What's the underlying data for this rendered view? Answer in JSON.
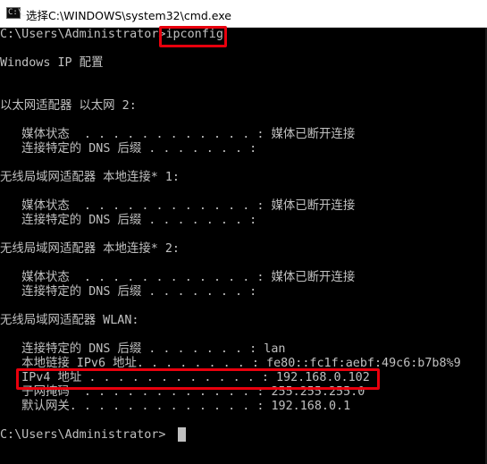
{
  "window": {
    "title": "选择C:\\WINDOWS\\system32\\cmd.exe",
    "icon": "cmd-console-icon",
    "icon_glyph": "C:\\_"
  },
  "console": {
    "prompt1": "C:\\Users\\Administrator>",
    "command": "ipconfig",
    "header": "Windows IP 配置",
    "ethernet": {
      "title": "以太网适配器 以太网 2:",
      "media_state": "   媒体状态  . . . . . . . . . . . . : 媒体已断开连接",
      "dns_suffix": "   连接特定的 DNS 后缀 . . . . . . . :"
    },
    "lan1": {
      "title": "无线局域网适配器 本地连接* 1:",
      "media_state": "   媒体状态  . . . . . . . . . . . . : 媒体已断开连接",
      "dns_suffix": "   连接特定的 DNS 后缀 . . . . . . . :"
    },
    "lan2": {
      "title": "无线局域网适配器 本地连接* 2:",
      "media_state": "   媒体状态  . . . . . . . . . . . . : 媒体已断开连接",
      "dns_suffix": "   连接特定的 DNS 后缀 . . . . . . . :"
    },
    "wlan": {
      "title": "无线局域网适配器 WLAN:",
      "dns_suffix": "   连接特定的 DNS 后缀 . . . . . . . : lan",
      "ipv6": "   本地链接 IPv6 地址. . . . . . . . : fe80::fc1f:aebf:49c6:b7b8%9",
      "ipv4": "   IPv4 地址 . . . . . . . . . . . . : 192.168.0.102",
      "subnet": "   子网掩码  . . . . . . . . . . . . : 255.255.255.0",
      "gateway": "   默认网关. . . . . . . . . . . . . : 192.168.0.1"
    },
    "prompt2": "C:\\Users\\Administrator>"
  },
  "highlight_color": "#e8000d"
}
